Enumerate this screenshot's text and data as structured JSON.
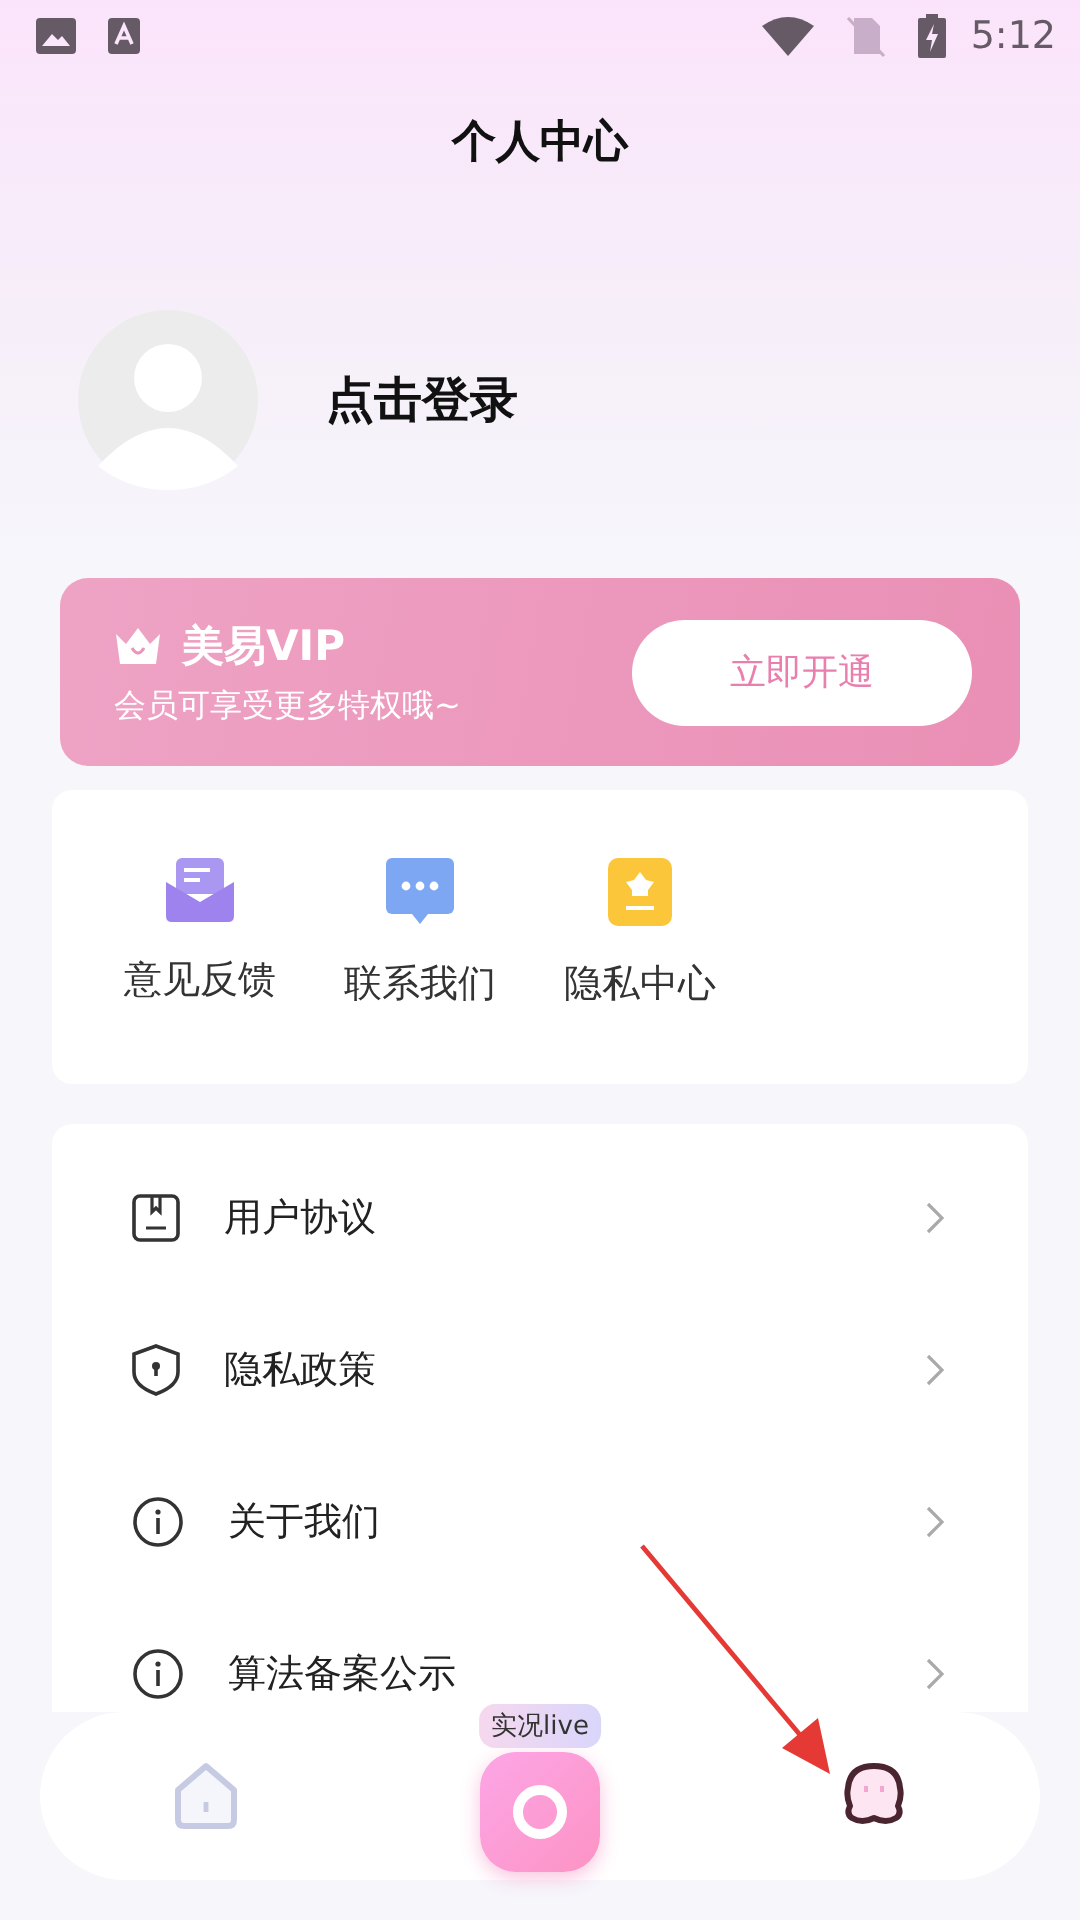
{
  "status_bar": {
    "time": "5:12"
  },
  "title": "个人中心",
  "profile": {
    "login_label": "点击登录"
  },
  "vip": {
    "name": "美易VIP",
    "subtitle": "会员可享受更多特权哦~",
    "button": "立即开通"
  },
  "shortcuts": [
    {
      "kind": "feedback",
      "label": "意见反馈"
    },
    {
      "kind": "contact",
      "label": "联系我们"
    },
    {
      "kind": "privacy",
      "label": "隐私中心"
    }
  ],
  "menu": [
    {
      "kind": "agreement",
      "label": "用户协议"
    },
    {
      "kind": "policy",
      "label": "隐私政策"
    },
    {
      "kind": "info",
      "label": "关于我们"
    },
    {
      "kind": "info",
      "label": "算法备案公示"
    }
  ],
  "bottom_nav": [
    {
      "kind": "home",
      "selected": false
    },
    {
      "kind": "camera",
      "badge": "实况live",
      "selected": false
    },
    {
      "kind": "profile",
      "selected": true
    }
  ]
}
